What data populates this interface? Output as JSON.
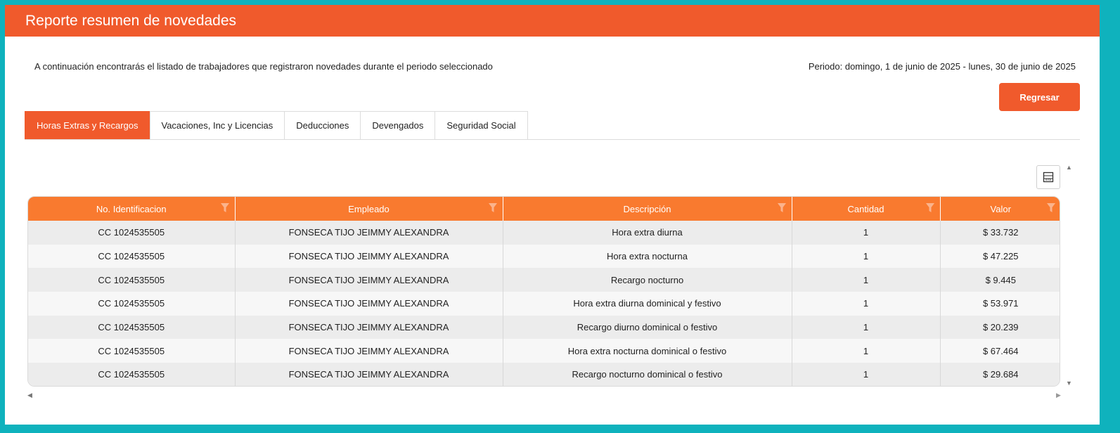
{
  "header": {
    "title": "Reporte resumen de novedades"
  },
  "info": {
    "description": "A continuación encontrarás el listado de trabajadores que registraron novedades durante el periodo seleccionado",
    "period": "Periodo: domingo, 1 de junio de 2025 - lunes, 30 de junio de 2025"
  },
  "actions": {
    "back_label": "Regresar",
    "export_icon": "excel-export-icon"
  },
  "tabs": [
    {
      "label": "Horas Extras y Recargos",
      "active": true
    },
    {
      "label": "Vacaciones, Inc y Licencias"
    },
    {
      "label": "Deducciones"
    },
    {
      "label": "Devengados"
    },
    {
      "label": "Seguridad Social"
    }
  ],
  "table": {
    "columns": [
      "No. Identificacion",
      "Empleado",
      "Descripción",
      "Cantidad",
      "Valor"
    ],
    "rows": [
      [
        "CC 1024535505",
        "FONSECA TIJO JEIMMY ALEXANDRA",
        "Hora extra diurna",
        "1",
        "$ 33.732"
      ],
      [
        "CC 1024535505",
        "FONSECA TIJO JEIMMY ALEXANDRA",
        "Hora extra nocturna",
        "1",
        "$ 47.225"
      ],
      [
        "CC 1024535505",
        "FONSECA TIJO JEIMMY ALEXANDRA",
        "Recargo nocturno",
        "1",
        "$ 9.445"
      ],
      [
        "CC 1024535505",
        "FONSECA TIJO JEIMMY ALEXANDRA",
        "Hora extra diurna dominical y festivo",
        "1",
        "$ 53.971"
      ],
      [
        "CC 1024535505",
        "FONSECA TIJO JEIMMY ALEXANDRA",
        "Recargo diurno dominical o festivo",
        "1",
        "$ 20.239"
      ],
      [
        "CC 1024535505",
        "FONSECA TIJO JEIMMY ALEXANDRA",
        "Hora extra nocturna dominical o festivo",
        "1",
        "$ 67.464"
      ],
      [
        "CC 1024535505",
        "FONSECA TIJO JEIMMY ALEXANDRA",
        "Recargo nocturno dominical o festivo",
        "1",
        "$ 29.684"
      ]
    ]
  },
  "colors": {
    "accent": "#f05a2c",
    "table_header": "#f97a2f",
    "frame": "#0fb2bd"
  }
}
